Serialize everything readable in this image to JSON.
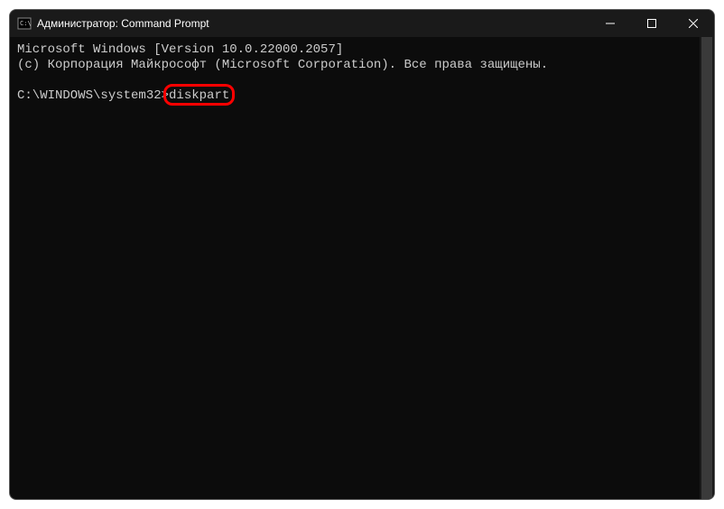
{
  "titlebar": {
    "title": "Администратор: Command Prompt"
  },
  "terminal": {
    "line1": "Microsoft Windows [Version 10.0.22000.2057]",
    "line2": "(c) Корпорация Майкрософт (Microsoft Corporation). Все права защищены.",
    "prompt": "C:\\WINDOWS\\system32>",
    "command": "diskpart"
  },
  "highlight": {
    "target": "command-input"
  }
}
